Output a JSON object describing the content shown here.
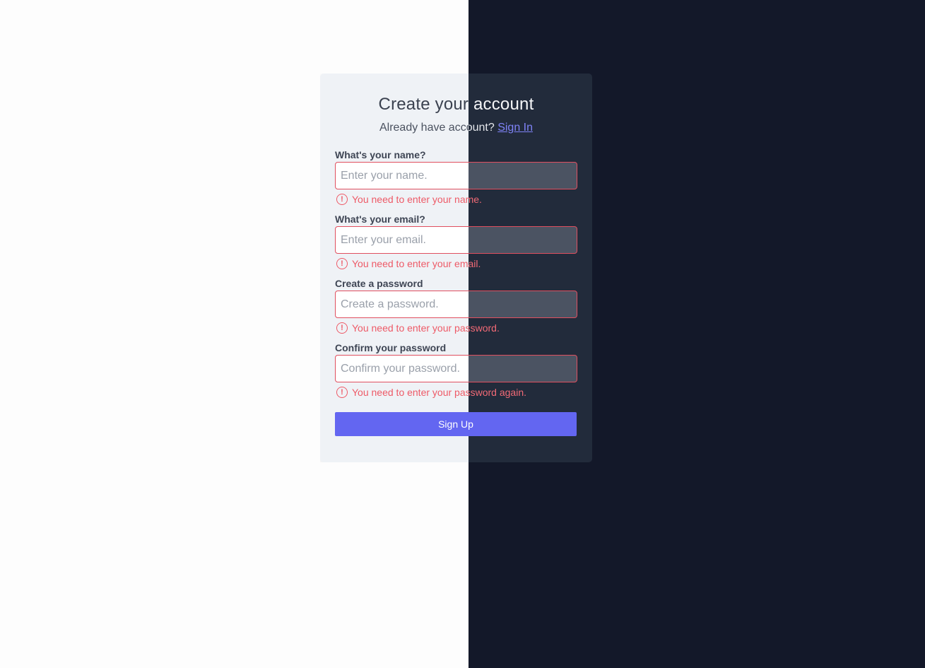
{
  "form": {
    "title": "Create your account",
    "subtitle_text": "Already have account?",
    "signin_link": "Sign In",
    "fields": [
      {
        "label": "What's your name?",
        "placeholder": "Enter your name.",
        "error": "You need to enter your name."
      },
      {
        "label": "What's your email?",
        "placeholder": "Enter your email.",
        "error": "You need to enter your email."
      },
      {
        "label": "Create a password",
        "placeholder": "Create a password.",
        "error": "You need to enter your password."
      },
      {
        "label": "Confirm your password",
        "placeholder": "Confirm your password.",
        "error": "You need to enter your password again."
      }
    ],
    "submit_label": "Sign Up",
    "error_icon": "!"
  },
  "colors": {
    "accent": "#6366f1",
    "error": "#e04f5f",
    "light_background": "#fdfdfd",
    "dark_background": "#131829"
  }
}
